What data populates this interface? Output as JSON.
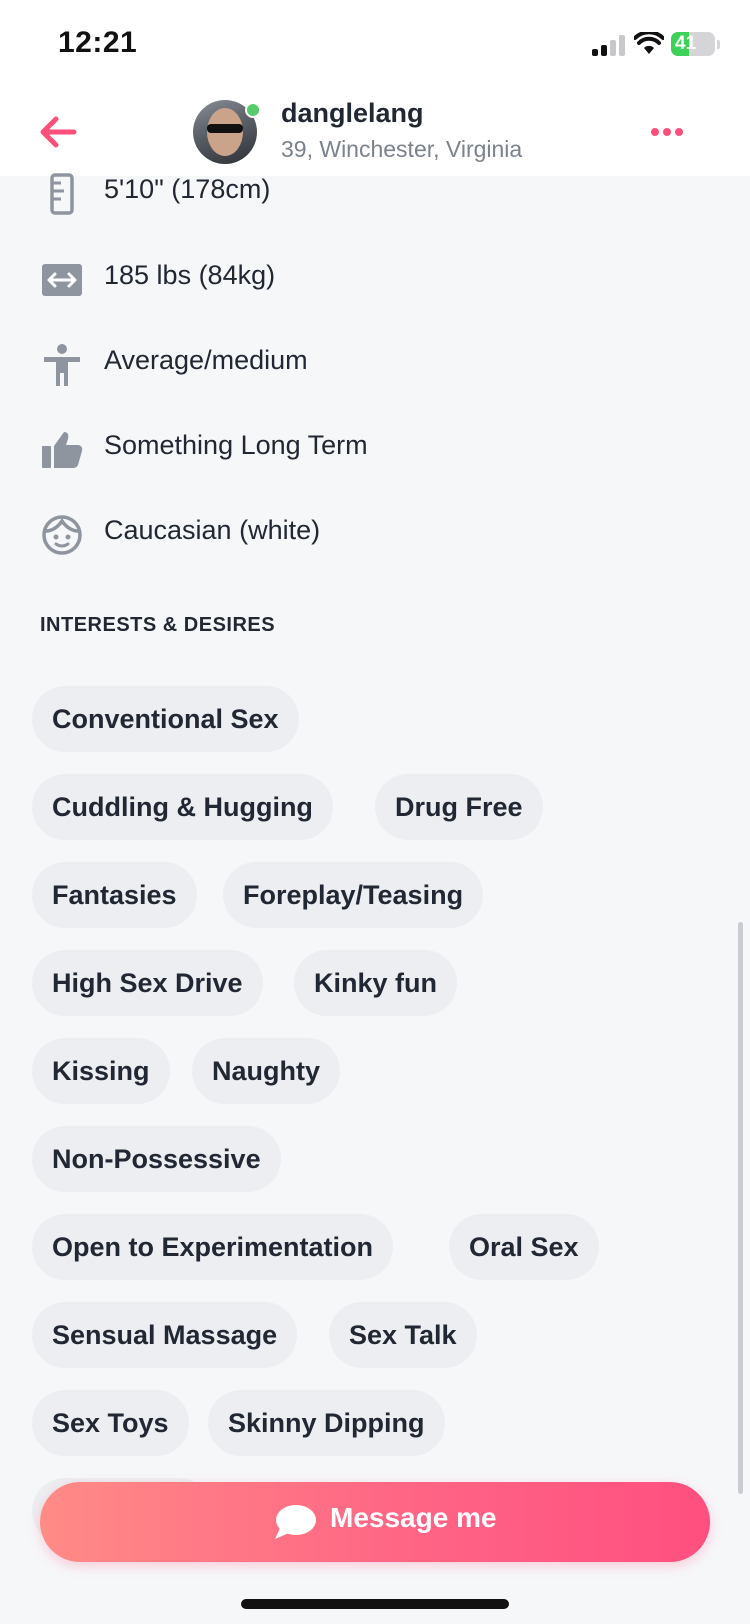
{
  "status_bar": {
    "time": "12:21",
    "battery": "41",
    "battery_level": 0.41
  },
  "header": {
    "back_icon": "arrow-left-icon",
    "username": "danglelang",
    "subline": "39, Winchester, Virginia",
    "more_icon": "more-horizontal-icon",
    "accent_color": "#ff4f7b"
  },
  "attributes": [
    {
      "icon": "ruler-icon",
      "label": "5'10\" (178cm)"
    },
    {
      "icon": "weight-icon",
      "label": "185 lbs (84kg)"
    },
    {
      "icon": "body-type-icon",
      "label": "Average/medium"
    },
    {
      "icon": "thumbs-up-icon",
      "label": "Something Long Term"
    },
    {
      "icon": "face-icon",
      "label": "Caucasian (white)"
    }
  ],
  "interests": {
    "title": "INTERESTS & DESIRES",
    "chips": [
      "Conventional Sex",
      "Cuddling & Hugging",
      "Drug Free",
      "Fantasies",
      "Foreplay/Teasing",
      "High Sex Drive",
      "Kinky fun",
      "Kissing",
      "Naughty",
      "Non-Possessive",
      "Open to Experimentation",
      "Oral Sex",
      "Sensual Massage",
      "Sex Talk",
      "Sex Toys",
      "Skinny Dipping"
    ]
  },
  "message_button": {
    "label": "Message me",
    "icon": "chat-bubble-icon"
  }
}
